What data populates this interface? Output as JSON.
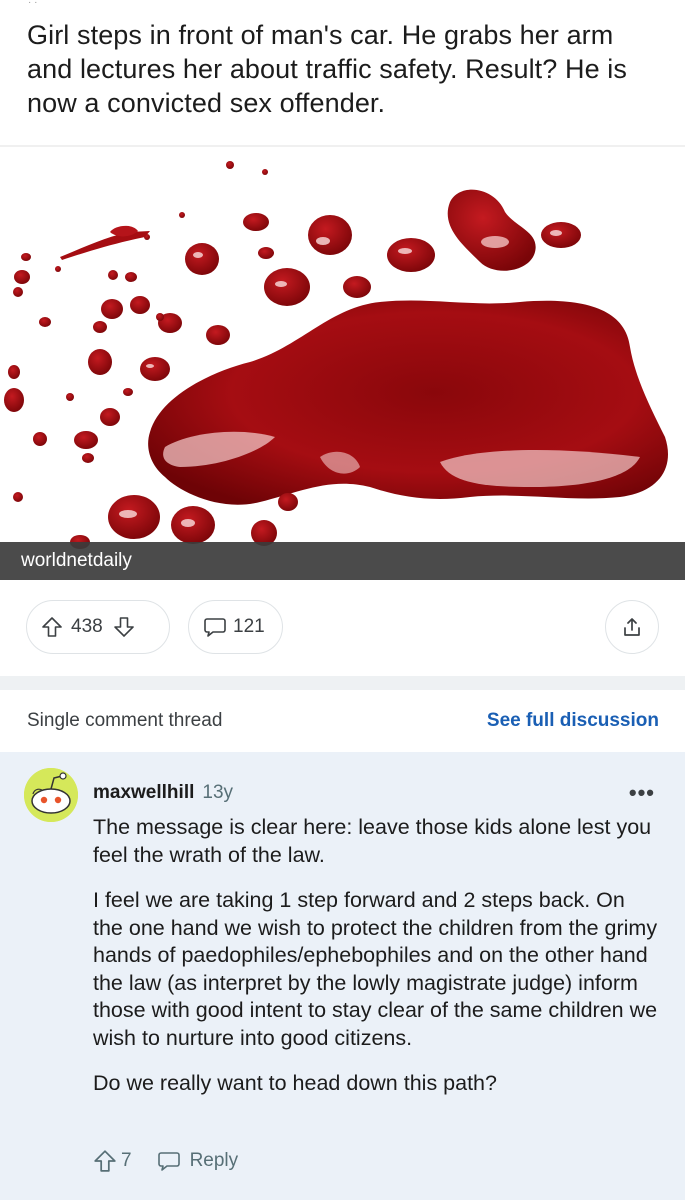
{
  "post": {
    "title": "Girl steps in front of man's car. He grabs her arm and lectures her about traffic safety. Result? He is now a convicted sex offender.",
    "media_source": "worldnetdaily",
    "upvotes": "438",
    "comments": "121"
  },
  "thread": {
    "label": "Single comment thread",
    "see_full": "See full discussion"
  },
  "comment": {
    "author": "maxwellhill",
    "age": "13y",
    "paragraphs": [
      "The message is clear here: leave those kids alone lest you feel the wrath of the law.",
      "I feel we are taking 1 step forward and 2 steps back. On the one hand we wish to protect the children from the grimy hands of paedophiles/ephebophiles and on the other hand the law (as interpret by the lowly magistrate judge) inform those with good intent to stay clear of the same children we wish to nurture into good citizens.",
      "Do we really want to head down this path?"
    ],
    "votes": "7",
    "reply_label": "Reply"
  },
  "icons": {
    "upvote": "arrow-up-icon",
    "downvote": "arrow-down-icon",
    "comment": "speech-bubble-icon",
    "share": "share-icon",
    "more": "more-dots-icon",
    "reply": "reply-bubble-icon"
  },
  "colors": {
    "link_blue": "#1a5fb4",
    "comment_bg": "#ebf1f8",
    "blood_red": "#9e0a0f"
  }
}
